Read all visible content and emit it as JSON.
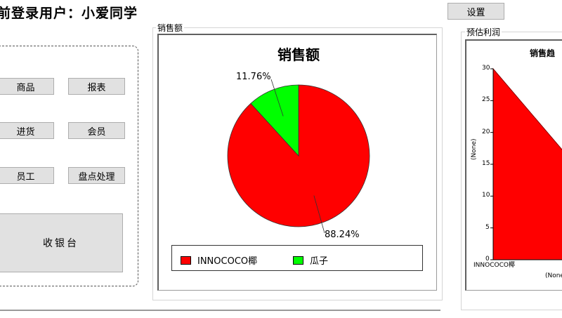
{
  "header": {
    "login_user": "前登录用户：小爱同学"
  },
  "settings": {
    "label": "设置"
  },
  "menu": {
    "product": "商品",
    "report": "报表",
    "purchase": "进货",
    "member": "会员",
    "staff": "员工",
    "inventory": "盘点处理",
    "cashier": "收银台"
  },
  "sales_group": {
    "caption": "销售额"
  },
  "profit_group": {
    "caption": "预估利润"
  },
  "colors": {
    "red": "#ff0000",
    "green": "#00ff00"
  },
  "chart_data": [
    {
      "type": "pie",
      "title": "销售额",
      "slices": [
        {
          "label": "INNOCOCO椰",
          "value": 88.24,
          "percent_label": "88.24%",
          "color": "#ff0000"
        },
        {
          "label": "瓜子",
          "value": 11.76,
          "percent_label": "11.76%",
          "color": "#00ff00"
        }
      ],
      "legend_position": "bottom"
    },
    {
      "type": "area",
      "title": "销售趋",
      "x": [
        "INNOCOCO椰"
      ],
      "y_ticks": [
        "0",
        "5",
        "10",
        "15",
        "20",
        "25",
        "30"
      ],
      "ylim": [
        0,
        30
      ],
      "ylabel": "(None)",
      "xlabel": "(None)",
      "series": [
        {
          "values": [
            30,
            15.5
          ]
        }
      ]
    }
  ]
}
